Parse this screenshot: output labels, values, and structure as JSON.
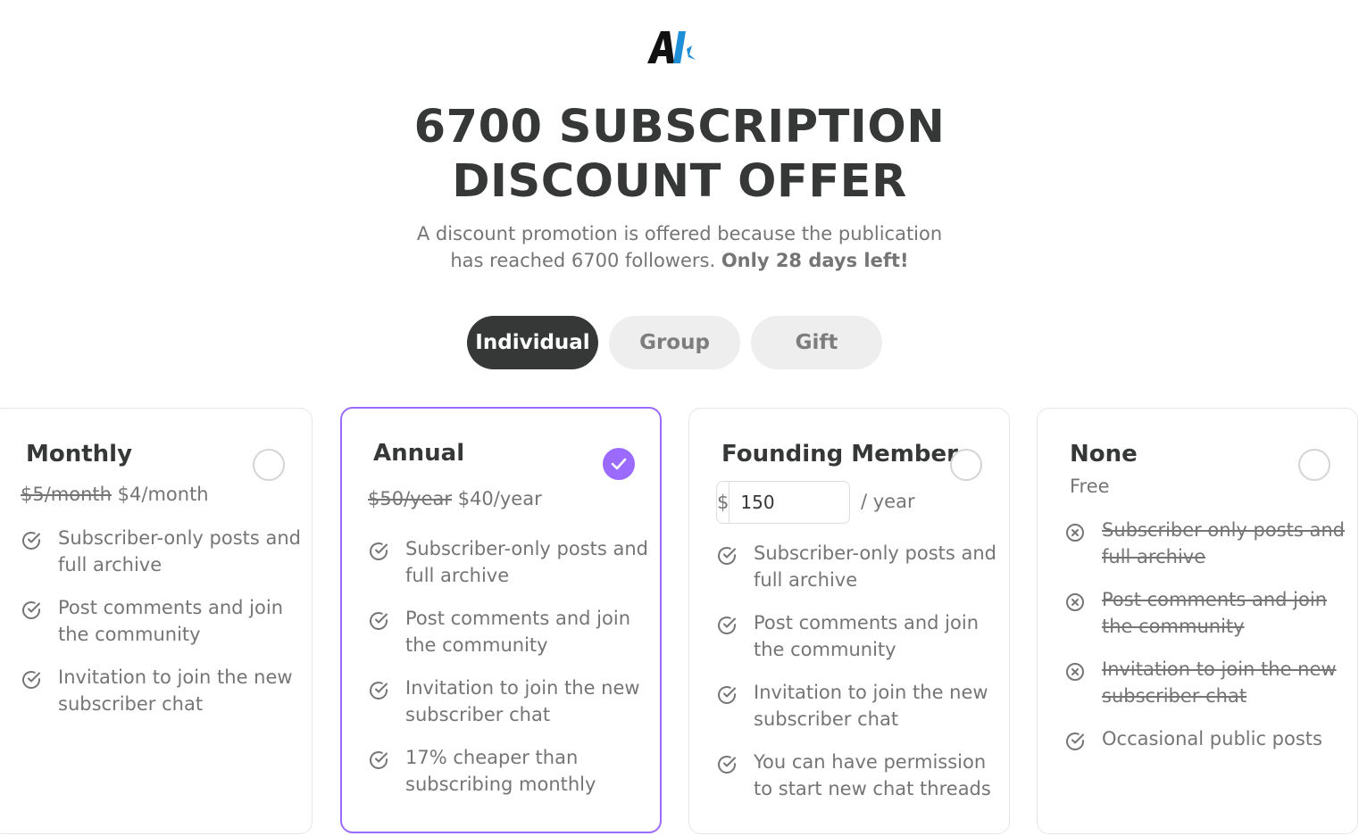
{
  "header": {
    "title_line1": "6700 SUBSCRIPTION",
    "title_line2": "DISCOUNT OFFER",
    "subtitle_line1": "A discount promotion is offered because the publication",
    "subtitle_line2_prefix": "has reached 6700 followers. ",
    "subtitle_line2_bold": "Only 28 days left!"
  },
  "tabs": [
    {
      "label": "Individual",
      "active": true
    },
    {
      "label": "Group",
      "active": false
    },
    {
      "label": "Gift",
      "active": false
    }
  ],
  "plans": {
    "monthly": {
      "title": "Monthly",
      "old_price": "$5/month",
      "new_price": "$4/month",
      "selected": false,
      "features": [
        "Subscriber-only posts and full archive",
        "Post comments and join the community",
        "Invitation to join the new subscriber chat"
      ]
    },
    "annual": {
      "title": "Annual",
      "old_price": "$50/year",
      "new_price": "$40/year",
      "selected": true,
      "features": [
        "Subscriber-only posts and full archive",
        "Post comments and join the community",
        "Invitation to join the new subscriber chat",
        "17% cheaper than subscribing monthly"
      ]
    },
    "founding": {
      "title": "Founding Member",
      "currency": "$",
      "amount": "150",
      "period": "/ year",
      "selected": false,
      "features": [
        "Subscriber-only posts and full archive",
        "Post comments and join the community",
        "Invitation to join the new subscriber chat",
        "You can have permission to start new chat threads"
      ]
    },
    "none": {
      "title": "None",
      "price": "Free",
      "selected": false,
      "features_excluded": [
        "Subscriber-only posts and full archive",
        "Post comments and join the community",
        "Invitation to join the new subscriber chat"
      ],
      "features_included": [
        "Occasional public posts"
      ]
    }
  },
  "colors": {
    "accent": "#9b6bff",
    "text_dark": "#363737",
    "text_muted": "#757575",
    "tab_inactive_bg": "#eeeeee"
  },
  "icons": {
    "included": "check-circle-icon",
    "excluded": "x-circle-icon",
    "selected": "checkmark-icon",
    "logo": "ai-logo"
  }
}
